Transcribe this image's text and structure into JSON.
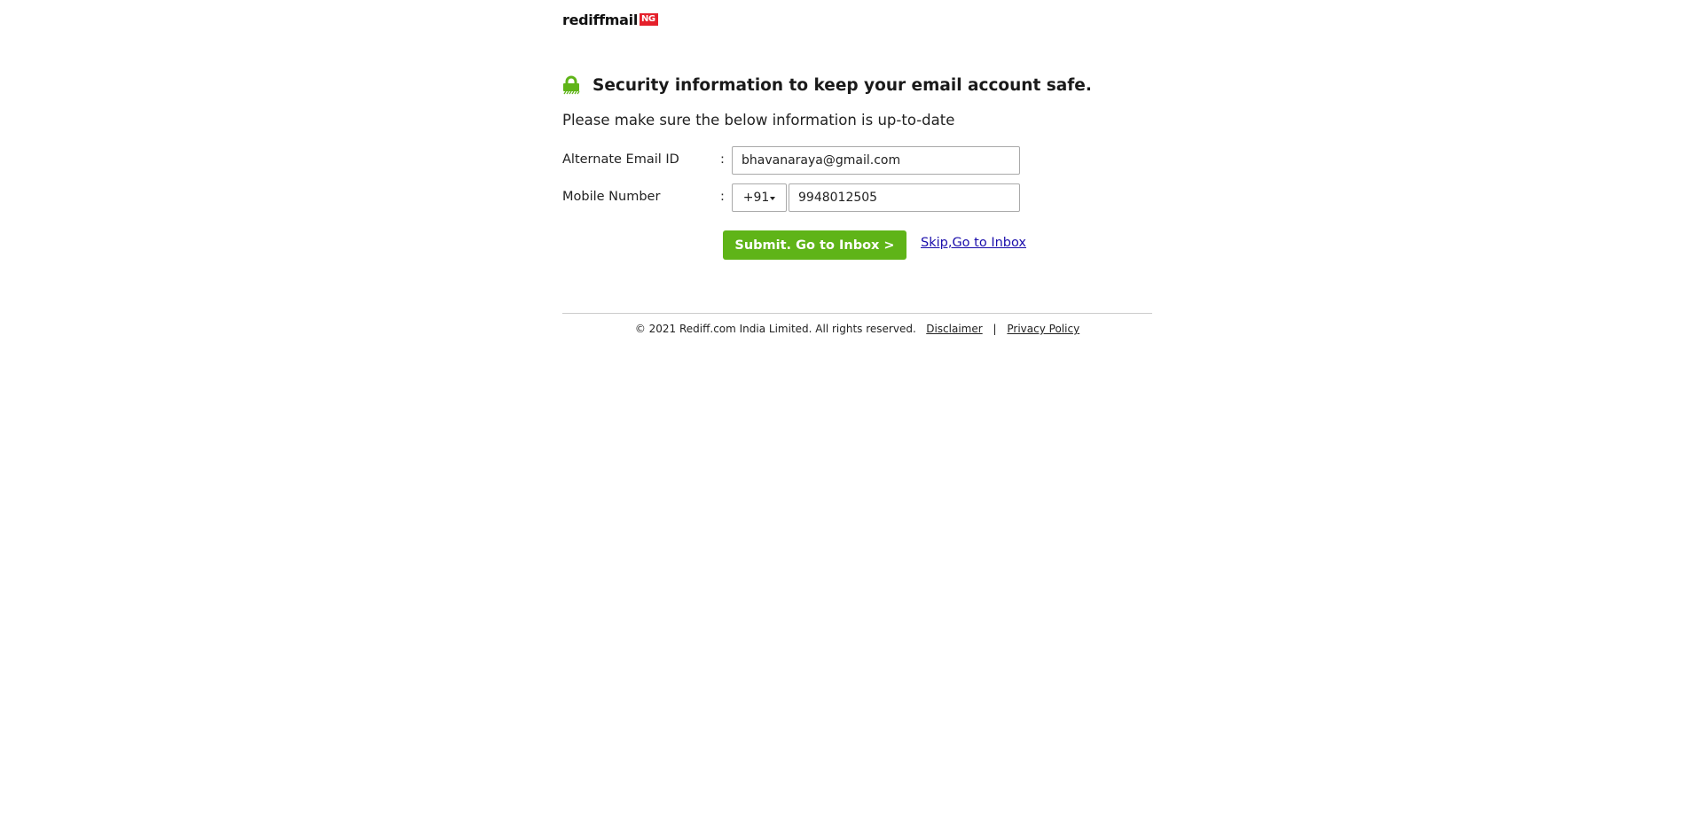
{
  "logo": {
    "word": "rediffmail",
    "badge": "NG",
    "badge_color": "#e5202b"
  },
  "header": {
    "lock_icon": "lock-icon",
    "lock_color": "#5fb418",
    "title": "Security information to keep your email account safe.",
    "subtitle": "Please make sure the below information is up-to-date"
  },
  "form": {
    "email": {
      "label": "Alternate Email ID",
      "colon": ":",
      "value": "bhavanaraya@gmail.com"
    },
    "mobile": {
      "label": "Mobile Number",
      "colon": ":",
      "country_code": "+91",
      "value": "9948012505"
    },
    "submit_label": "Submit. Go to Inbox >",
    "submit_color": "#5fb418",
    "skip_label": "Skip,Go to Inbox"
  },
  "footer": {
    "copyright": "© 2021 Rediff.com India Limited. All rights reserved.",
    "disclaimer": "Disclaimer",
    "separator": "|",
    "privacy": "Privacy Policy"
  }
}
